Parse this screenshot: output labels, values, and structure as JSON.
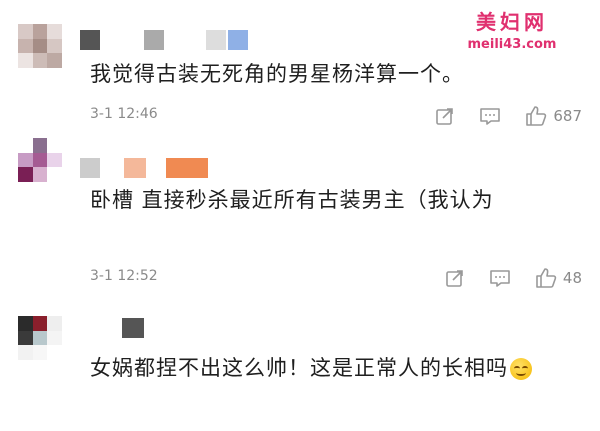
{
  "watermark": {
    "title": "美妇网",
    "url": "meili43.com"
  },
  "comments": [
    {
      "text": "我觉得古装无死角的男星杨洋算一个。",
      "time": "3-1 12:46",
      "likes": "687",
      "avatar_colors": [
        "#d8c9c6",
        "#b9a29c",
        "#e6dcda",
        "#c7b3ae",
        "#a58d86",
        "#d6c7c3",
        "#ece4e2",
        "#cdbcb7",
        "#bda9a3"
      ],
      "name_colors": [
        "#555555",
        "#aaaaaa",
        "#dddddd",
        "#8fb0e6"
      ]
    },
    {
      "text": "卧槽 直接秒杀最近所有古装男主（我认为",
      "time": "3-1 12:52",
      "likes": "48",
      "avatar_colors": [
        "#ffffff",
        "#8a6f8f",
        "#ffffff",
        "#c79bc4",
        "#a55b93",
        "#e9d3ea",
        "#7a1f55",
        "#d8b1cf",
        "#ffffff"
      ],
      "name_colors": [
        "#cccccc",
        "#f4b89a",
        "#f08a52"
      ]
    },
    {
      "text": "女娲都捏不出这么帅！这是正常人的长相吗",
      "avatar_colors": [
        "#2b2b2b",
        "#8a1f2c",
        "#eeeeee",
        "#3a3a3a",
        "#b8c8cc",
        "#f4f4f4",
        "#f2f2f2",
        "#f7f7f7",
        "#ffffff"
      ],
      "name_colors": [
        "#555555"
      ]
    }
  ],
  "icons": {
    "share": "share-icon",
    "comment": "comment-icon",
    "like": "thumbs-up-icon",
    "emoji": "smirk-emoji-icon"
  }
}
